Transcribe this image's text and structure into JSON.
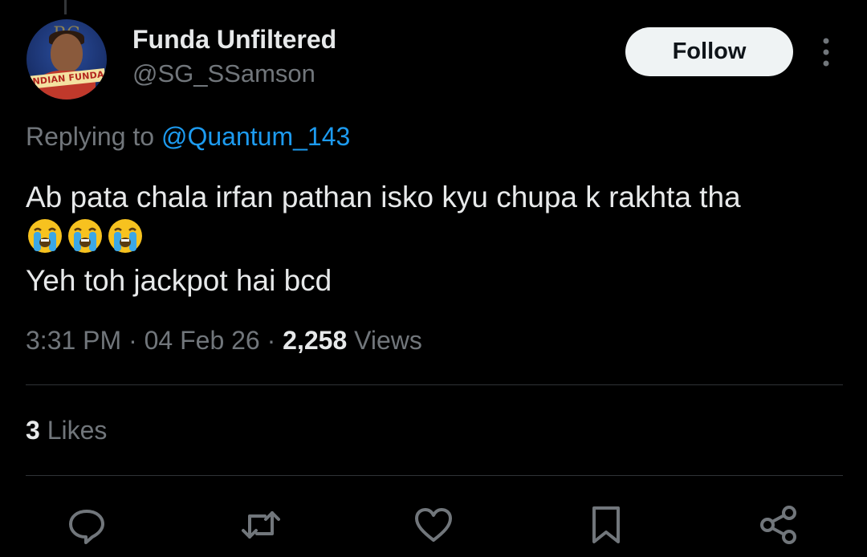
{
  "author": {
    "display_name": "Funda Unfiltered",
    "handle": "@SG_SSamson",
    "avatar_text": "INDIAN FUNDA"
  },
  "follow_label": "Follow",
  "reply": {
    "prefix": "Replying to ",
    "mention": "@Quantum_143"
  },
  "tweet": {
    "line1": "Ab pata chala irfan pathan isko kyu chupa k rakhta tha",
    "emojis": [
      "loudly-crying-face",
      "loudly-crying-face",
      "loudly-crying-face"
    ],
    "line2": "Yeh toh jackpot hai bcd"
  },
  "meta": {
    "time": "3:31 PM",
    "sep1": " · ",
    "date": "04 Feb 26",
    "sep2": " · ",
    "views_count": "2,258",
    "views_label": " Views"
  },
  "likes": {
    "count": "3",
    "label": " Likes"
  },
  "actions": [
    "reply-icon",
    "retweet-icon",
    "like-icon",
    "bookmark-icon",
    "share-icon"
  ],
  "colors": {
    "background": "#000000",
    "text": "#e7e9ea",
    "muted": "#71767b",
    "link": "#1d9bf0",
    "follow_bg": "#eff3f4"
  }
}
